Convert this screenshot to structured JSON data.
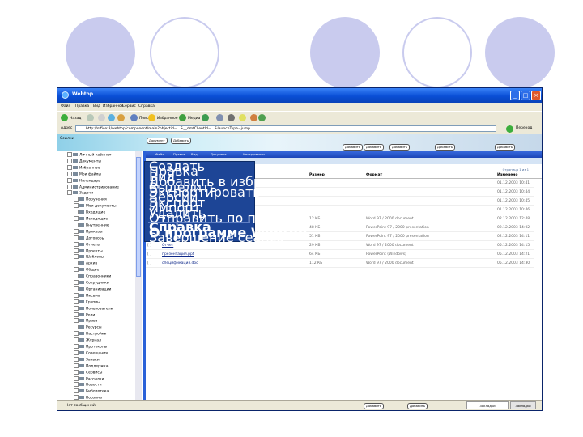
{
  "slide": {
    "circle_color": "#c9cbee"
  },
  "window": {
    "title": "Webtop",
    "controls": [
      "_",
      "□",
      "×"
    ]
  },
  "menubar": [
    "Файл",
    "Правка",
    "Вид",
    "Избранное",
    "Сервис",
    "Справка"
  ],
  "toolbar": {
    "back": "Назад",
    "search": "Поиск",
    "favorites": "Избранное",
    "media": "Медиа"
  },
  "address": {
    "label": "Адрес",
    "url": "http://office:8/webtop/component/main?objectid=...&__dmfClientId=...&launchType=jump",
    "go": "Переход",
    "links": "Ссылки"
  },
  "banner_buttons": [
    "Документ",
    "Добавить",
    "Добавить",
    "Добавить",
    "Добавить",
    "Добавить",
    "Добавить"
  ],
  "sidebar": {
    "items": [
      {
        "label": "Личный кабинет",
        "indent": 0
      },
      {
        "label": "Документы",
        "indent": 0
      },
      {
        "label": "Избранное",
        "indent": 0
      },
      {
        "label": "Мои файлы",
        "indent": 0
      },
      {
        "label": "Календарь",
        "indent": 0
      },
      {
        "label": "Администрирование",
        "indent": 0
      },
      {
        "label": "Задачи",
        "indent": 0
      },
      {
        "label": "Поручения",
        "indent": 1
      },
      {
        "label": "Мои документы",
        "indent": 1
      },
      {
        "label": "Входящие",
        "indent": 1
      },
      {
        "label": "Исходящие",
        "indent": 1
      },
      {
        "label": "Внутренние",
        "indent": 1
      },
      {
        "label": "Приказы",
        "indent": 1
      },
      {
        "label": "Договоры",
        "indent": 1
      },
      {
        "label": "Отчеты",
        "indent": 1
      },
      {
        "label": "Проекты",
        "indent": 1
      },
      {
        "label": "Шаблоны",
        "indent": 1
      },
      {
        "label": "Архив",
        "indent": 1
      },
      {
        "label": "Общие",
        "indent": 1
      },
      {
        "label": "Справочники",
        "indent": 1
      },
      {
        "label": "Сотрудники",
        "indent": 1
      },
      {
        "label": "Организации",
        "indent": 1
      },
      {
        "label": "Письма",
        "indent": 1
      },
      {
        "label": "Группы",
        "indent": 1
      },
      {
        "label": "Пользователи",
        "indent": 1
      },
      {
        "label": "Роли",
        "indent": 1
      },
      {
        "label": "Права",
        "indent": 1
      },
      {
        "label": "Ресурсы",
        "indent": 1
      },
      {
        "label": "Настройки",
        "indent": 1
      },
      {
        "label": "Журнал",
        "indent": 1
      },
      {
        "label": "Протоколы",
        "indent": 1
      },
      {
        "label": "Совещания",
        "indent": 1
      },
      {
        "label": "Заявки",
        "indent": 1
      },
      {
        "label": "Поддержка",
        "indent": 1
      },
      {
        "label": "Сервисы",
        "indent": 1
      },
      {
        "label": "Рассылки",
        "indent": 1
      },
      {
        "label": "Новости",
        "indent": 1
      },
      {
        "label": "Библиотека",
        "indent": 1
      },
      {
        "label": "Корзина",
        "indent": 1
      }
    ]
  },
  "content": {
    "header_tabs": [
      "Файл",
      "Правка",
      "Вид",
      "Документ",
      "Инструменты"
    ],
    "right_hint": "Страница 1 из 1",
    "columns": [
      "Имя",
      "Размер",
      "Формат",
      "Изменено"
    ],
    "rows": [
      {
        "size": "",
        "format": "",
        "date": "01.12.2003 10:41"
      },
      {
        "size": "",
        "format": "",
        "date": "01.12.2003 10:44"
      },
      {
        "size": "",
        "format": "",
        "date": "01.12.2003 10:45"
      },
      {
        "size": "",
        "format": "",
        "date": "01.12.2003 10:46"
      },
      {
        "size": "12 КБ",
        "format": "Word 97 / 2000 document",
        "date": "02.12.2003 12:48"
      },
      {
        "size": "48 КБ",
        "format": "PowerPoint 97 / 2000 presentation",
        "date": "02.12.2003 14:02"
      },
      {
        "size": "51 КБ",
        "format": "PowerPoint 97 / 2000 presentation",
        "date": "02.12.2003 14:11"
      },
      {
        "name": "Отчет",
        "size": "29 КБ",
        "format": "Word 97 / 2000 document",
        "date": "05.12.2003 14:15"
      },
      {
        "name": "презентация.ppt",
        "size": "64 КБ",
        "format": "PowerPoint (Windows)",
        "date": "05.12.2003 14:21"
      },
      {
        "name": "спецификация.doc",
        "size": "112 КБ",
        "format": "Word 97 / 2000 document",
        "date": "05.12.2003 14:30"
      }
    ]
  },
  "menu": {
    "items": [
      {
        "label": "Создать",
        "bold": false
      },
      {
        "label": "Правка",
        "bold": false
      },
      {
        "label": "Вид",
        "bold": false
      },
      {
        "label": "Добавить в избранное",
        "bold": false
      },
      {
        "label": "Выделить",
        "bold": false
      },
      {
        "label": "Экспортировать",
        "bold": false
      },
      {
        "label": "Версии",
        "bold": false
      },
      {
        "label": "Экспорт",
        "bold": false
      },
      {
        "label": "Импорт",
        "bold": false
      },
      {
        "label": "Удалить",
        "bold": false
      },
      {
        "label": "Отправить по почте",
        "bold": false
      },
      {
        "label": "Справка",
        "bold": true
      },
      {
        "label": "О программе Webtop",
        "bold": true
      },
      {
        "label": "Завершение сеанса",
        "bold": false
      }
    ]
  },
  "status": {
    "text": "Нет сообщений",
    "buttons": [
      "Добавить",
      "Добавить"
    ],
    "tabs": [
      "Закладки",
      "Закладки"
    ]
  }
}
